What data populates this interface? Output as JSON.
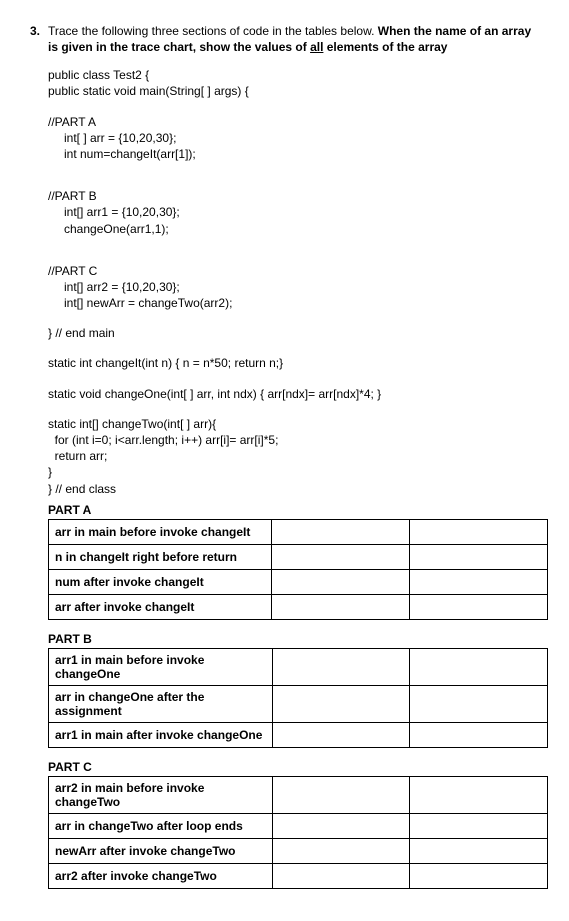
{
  "question": {
    "number": "3.",
    "prompt_a": "Trace the following three sections of code in the tables below. ",
    "prompt_b_bold": "When the name of an array is given in the trace chart, show the values of ",
    "prompt_c_underline": "all",
    "prompt_d_bold": " elements of the array"
  },
  "code": {
    "class_open": "public class Test2 {",
    "main_open": " public static void main(String[ ] args) {",
    "partA_label": "//PART A",
    "partA_line1": "int[ ] arr = {10,20,30};",
    "partA_line2": "int num=changeIt(arr[1]);",
    "partB_label": "//PART B",
    "partB_line1": "int[] arr1 = {10,20,30};",
    "partB_line2": "changeOne(arr1,1);",
    "partC_label": "//PART C",
    "partC_line1": "int[] arr2 = {10,20,30};",
    "partC_line2": "int[] newArr = changeTwo(arr2);",
    "end_main": "} // end main",
    "changeIt": "static int changeIt(int n) { n = n*50; return n;}",
    "changeOne": "static void changeOne(int[ ] arr, int ndx) { arr[ndx]= arr[ndx]*4; }",
    "changeTwo_open": "static int[] changeTwo(int[ ] arr){",
    "changeTwo_loop": "  for (int i=0; i<arr.length; i++) arr[i]= arr[i]*5;",
    "changeTwo_ret": "  return arr;",
    "changeTwo_close": "}",
    "end_class": "} // end class"
  },
  "tables": {
    "partA": {
      "title": "PART A",
      "rows": [
        "arr in main before invoke changeIt",
        "n in changeIt right before return",
        "num after invoke changeIt",
        "arr after invoke changeIt"
      ]
    },
    "partB": {
      "title": "PART B",
      "rows": [
        "arr1 in main before invoke changeOne",
        "arr in changeOne after the assignment",
        "arr1 in main after invoke changeOne"
      ]
    },
    "partC": {
      "title": "PART C",
      "rows": [
        "arr2 in main before invoke changeTwo",
        "arr in changeTwo after loop ends",
        "newArr after invoke changeTwo",
        "arr2 after invoke changeTwo"
      ]
    }
  }
}
